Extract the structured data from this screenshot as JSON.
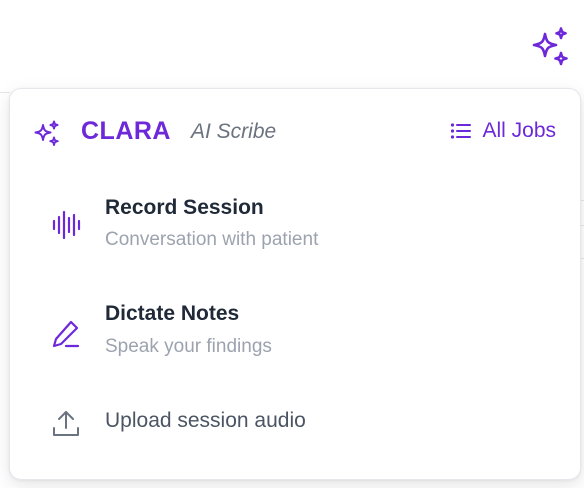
{
  "trigger": {
    "icon": "sparkles-icon"
  },
  "header": {
    "brand_icon": "sparkles-icon",
    "brand_name": "CLARA",
    "brand_sub": "AI Scribe",
    "all_jobs_icon": "list-icon",
    "all_jobs_label": "All Jobs"
  },
  "menu": {
    "items": [
      {
        "icon": "audio-waveform-icon",
        "title": "Record Session",
        "description": "Conversation with patient"
      },
      {
        "icon": "pen-icon",
        "title": "Dictate Notes",
        "description": "Speak your findings"
      },
      {
        "icon": "upload-icon",
        "title": "Upload session audio"
      }
    ]
  },
  "colors": {
    "accent": "#6d28d9",
    "title_text": "#1f2937",
    "muted_text": "#9ca3af",
    "secondary_text": "#6b7280",
    "upload_icon": "#6b7280"
  }
}
